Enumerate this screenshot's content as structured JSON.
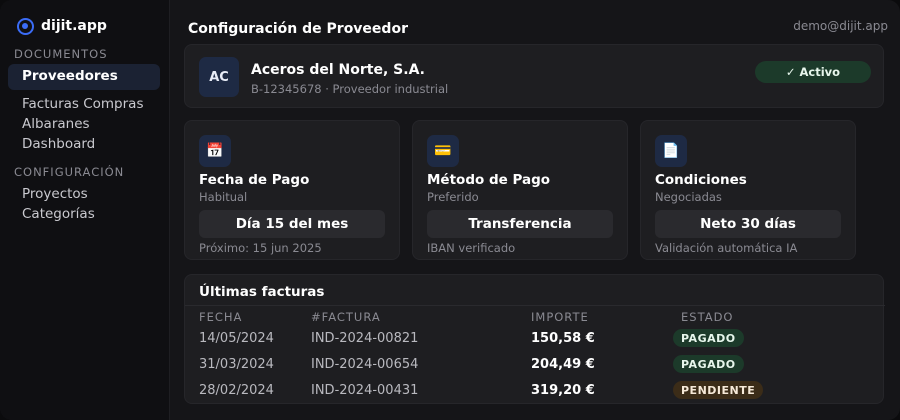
{
  "brand": {
    "name": "dijit.app"
  },
  "sidebar": {
    "sections": [
      {
        "label": "DOCUMENTOS"
      },
      {
        "label": "CONFIGURACIÓN"
      }
    ],
    "active_item": "Proveedores",
    "documentos_items": [
      "Facturas Compras",
      "Albaranes",
      "Dashboard"
    ],
    "config_items": [
      "Proyectos",
      "Categorías"
    ]
  },
  "header": {
    "title": "Configuración de Proveedor",
    "user_email": "demo@dijit.app"
  },
  "supplier": {
    "initials": "AC",
    "name": "Aceros del Norte, S.A.",
    "subtitle": "B-12345678 · Proveedor industrial",
    "status": "✓ Activo"
  },
  "info_cards": [
    {
      "icon": "calendar-icon",
      "glyph": "📅",
      "title": "Fecha de Pago",
      "subtitle": "Habitual",
      "value": "Día 15 del mes",
      "footer": "Próximo: 15 jun 2025"
    },
    {
      "icon": "card-icon",
      "glyph": "💳",
      "title": "Método de Pago",
      "subtitle": "Preferido",
      "value": "Transferencia",
      "footer": "IBAN verificado"
    },
    {
      "icon": "document-icon",
      "glyph": "📄",
      "title": "Condiciones",
      "subtitle": "Negociadas",
      "value": "Neto 30 días",
      "footer": "Validación automática IA"
    }
  ],
  "invoices": {
    "title": "Últimas facturas",
    "columns": [
      "FECHA",
      "#FACTURA",
      "IMPORTE",
      "ESTADO"
    ],
    "rows": [
      {
        "date": "14/05/2024",
        "number": "IND-2024-00821",
        "amount": "150,58 €",
        "status": "PAGADO",
        "status_type": "paid"
      },
      {
        "date": "31/03/2024",
        "number": "IND-2024-00654",
        "amount": "204,49 €",
        "status": "PAGADO",
        "status_type": "paid"
      },
      {
        "date": "28/02/2024",
        "number": "IND-2024-00431",
        "amount": "319,20 €",
        "status": "PENDIENTE",
        "status_type": "pending"
      }
    ]
  },
  "colors": {
    "accent": "#3b6cf6",
    "paid": "#1c3a2a",
    "pending": "#3b2c18"
  }
}
